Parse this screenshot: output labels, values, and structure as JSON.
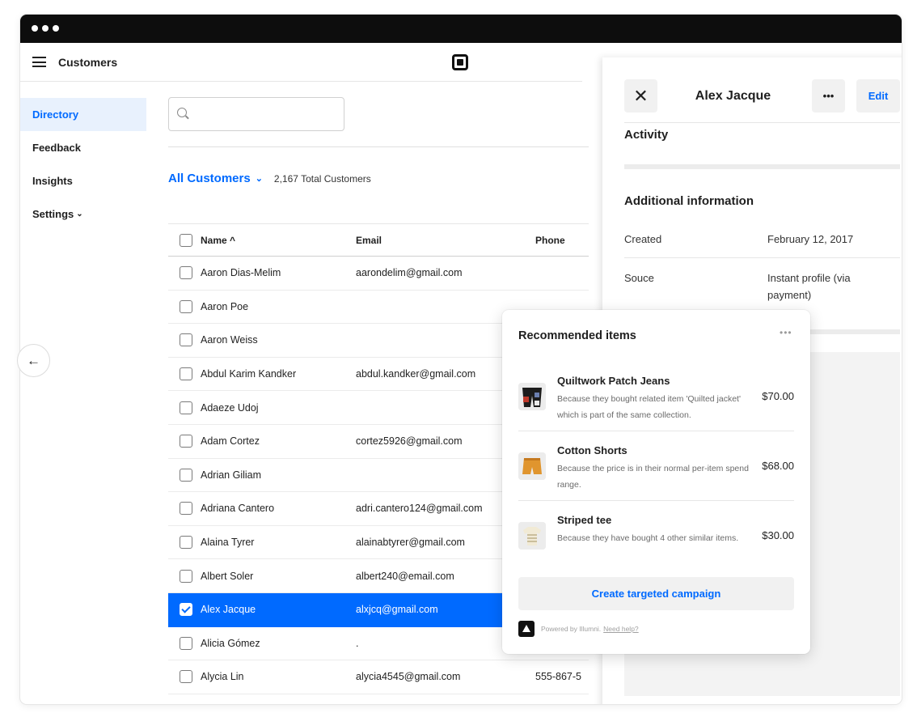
{
  "app": {
    "title": "Customers"
  },
  "sidebar": {
    "items": [
      {
        "label": "Directory",
        "active": true
      },
      {
        "label": "Feedback"
      },
      {
        "label": "Insights"
      },
      {
        "label": "Settings"
      }
    ],
    "settings_chevron": "⌄"
  },
  "search": {
    "placeholder": ""
  },
  "filter": {
    "label": "All Customers",
    "total": "2,167 Total Customers"
  },
  "table": {
    "columns": [
      "Name",
      "Email",
      "Phone"
    ],
    "sort_indicator": "^",
    "rows": [
      {
        "name": "Aaron Dias-Melim",
        "email": "aarondelim@gmail.com",
        "phone": ""
      },
      {
        "name": "Aaron Poe",
        "email": "",
        "phone": ""
      },
      {
        "name": "Aaron Weiss",
        "email": "",
        "phone": ""
      },
      {
        "name": "Abdul Karim Kandker",
        "email": "abdul.kandker@gmail.com",
        "phone": ""
      },
      {
        "name": "Adaeze Udoj",
        "email": "",
        "phone": ""
      },
      {
        "name": "Adam Cortez",
        "email": "cortez5926@gmail.com",
        "phone": ""
      },
      {
        "name": "Adrian Giliam",
        "email": "",
        "phone": ""
      },
      {
        "name": "Adriana Cantero",
        "email": "adri.cantero124@gmail.com",
        "phone": ""
      },
      {
        "name": "Alaina Tyrer",
        "email": "alainabtyrer@gmail.com",
        "phone": ""
      },
      {
        "name": "Albert Soler",
        "email": "albert240@email.com",
        "phone": ""
      },
      {
        "name": "Alex Jacque",
        "email": "alxjcq@gmail.com",
        "phone": "",
        "selected": true
      },
      {
        "name": "Alicia Gómez",
        "email": ".",
        "phone": ""
      },
      {
        "name": "Alycia Lin",
        "email": "alycia4545@gmail.com",
        "phone": "555-867-5"
      }
    ]
  },
  "panel": {
    "title": "Alex Jacque",
    "edit_label": "Edit",
    "more_label": "•••",
    "activity_heading": "Activity",
    "additional_heading": "Additional information",
    "fields": [
      {
        "label": "Created",
        "value": "February 12, 2017"
      },
      {
        "label": "Souce",
        "value": "Instant profile (via payment)"
      }
    ]
  },
  "recommended": {
    "title": "Recommended items",
    "more_label": "•••",
    "items": [
      {
        "name": "Quiltwork Patch Jeans",
        "reason": "Because they bought related item 'Quilted jacket' which is part of the same collection.",
        "price": "$70.00",
        "icon": "jeans-thumbnail"
      },
      {
        "name": "Cotton Shorts",
        "reason": "Because the price is in their normal per-item spend range.",
        "price": "$68.00",
        "icon": "shorts-thumbnail"
      },
      {
        "name": "Striped tee",
        "reason": "Because they have bought 4 other similar items.",
        "price": "$30.00",
        "icon": "tee-thumbnail"
      }
    ],
    "cta_label": "Create targeted campaign",
    "powered_by": "Powered by Illumni.",
    "help_link": "Need help?"
  },
  "colors": {
    "accent": "#006aff",
    "selected_row": "#006aff",
    "sidebar_active_bg": "#e8f1fd"
  }
}
